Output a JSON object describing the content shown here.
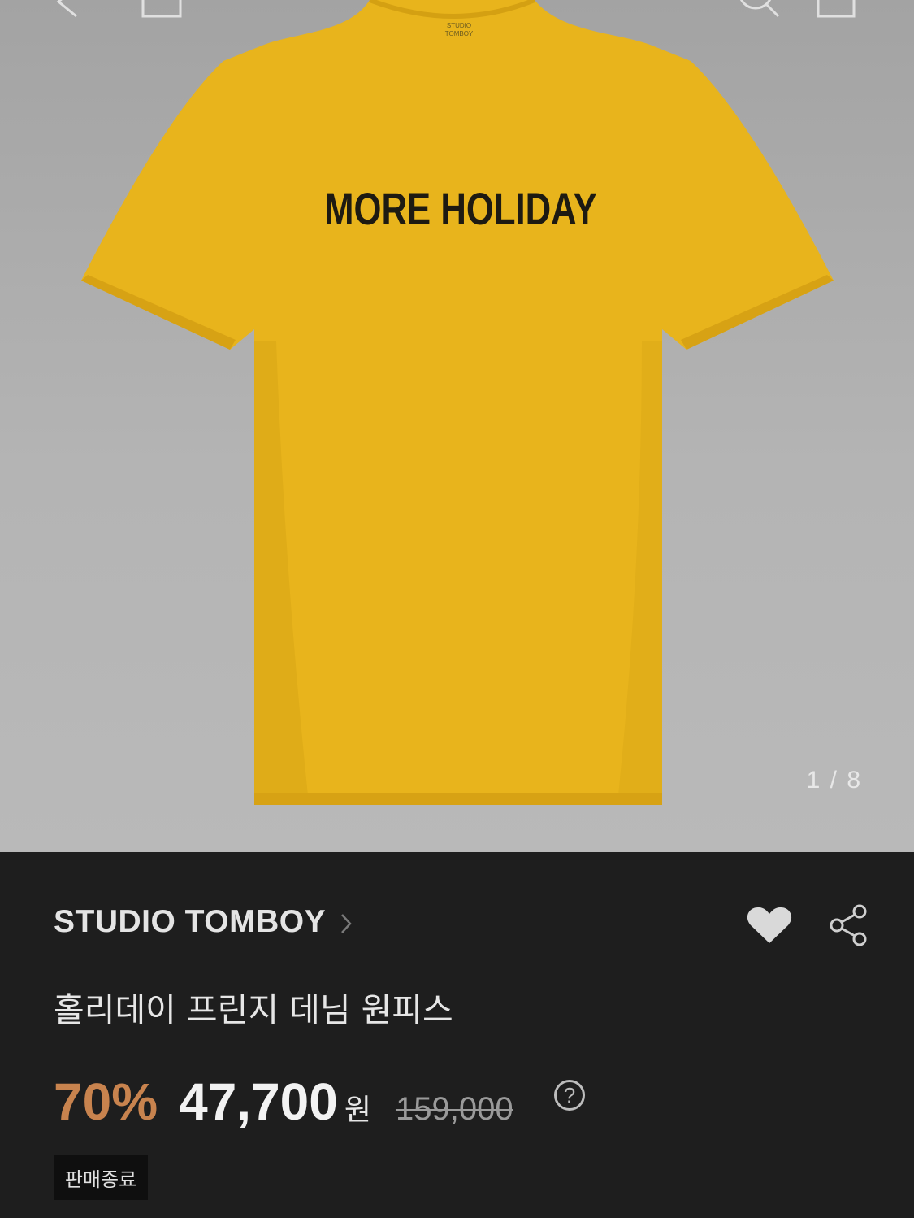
{
  "gallery": {
    "image_alt": "yellow t-shirt dress with MORE HOLIDAY print",
    "print_text": "MORE HOLIDAY",
    "counter": "1 / 8",
    "shirt_color": "#e7b31b",
    "background_color": "#b0b0b0"
  },
  "topbar": {
    "back_icon": "chevron-left-icon",
    "home_icon": "home-icon",
    "search_icon": "search-icon",
    "cart_icon": "cart-icon"
  },
  "product": {
    "brand": "STUDIO TOMBOY",
    "name": "홀리데이 프린지 데님 원피스",
    "discount": "70%",
    "price": "47,700",
    "currency": "원",
    "original_price": "159,000",
    "help": "?",
    "status_badge": "판매종료"
  },
  "colors": {
    "discount": "#c8834e",
    "info_background": "#1e1e1e"
  }
}
